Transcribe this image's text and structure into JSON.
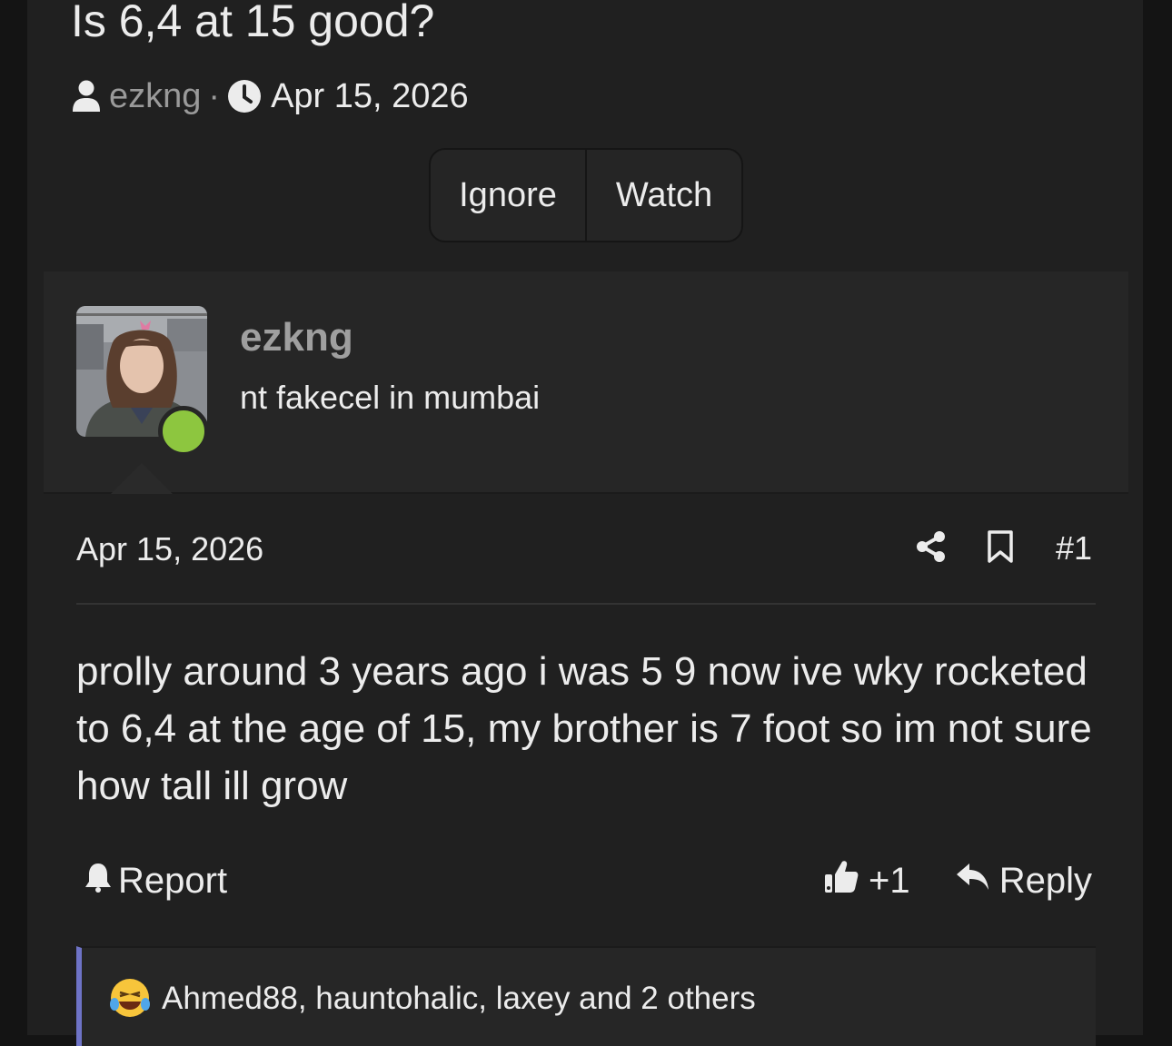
{
  "thread": {
    "title": "Is 6,4 at 15 good?",
    "author": "ezkng",
    "separator": "·",
    "date": "Apr 15, 2026",
    "buttons": {
      "ignore": "Ignore",
      "watch": "Watch"
    }
  },
  "post": {
    "user": {
      "name": "ezkng",
      "title": "nt fakecel in mumbai",
      "online": true
    },
    "date": "Apr 15, 2026",
    "number": "#1",
    "body": "prolly around 3 years ago i was 5 9 now ive wky rocketed to 6,4 at the age of 15, my brother is 7 foot so im not sure how tall ill grow",
    "actions": {
      "report": "Report",
      "reaction_count": "+1",
      "reply": "Reply"
    },
    "reactions": {
      "icon": "laughing-crying-emoji-icon",
      "text": "Ahmed88, hauntohalic, laxey and 2 others"
    }
  },
  "colors": {
    "background": "#202020",
    "online": "#8dc63f",
    "reactions_accent": "#6e73c6"
  }
}
